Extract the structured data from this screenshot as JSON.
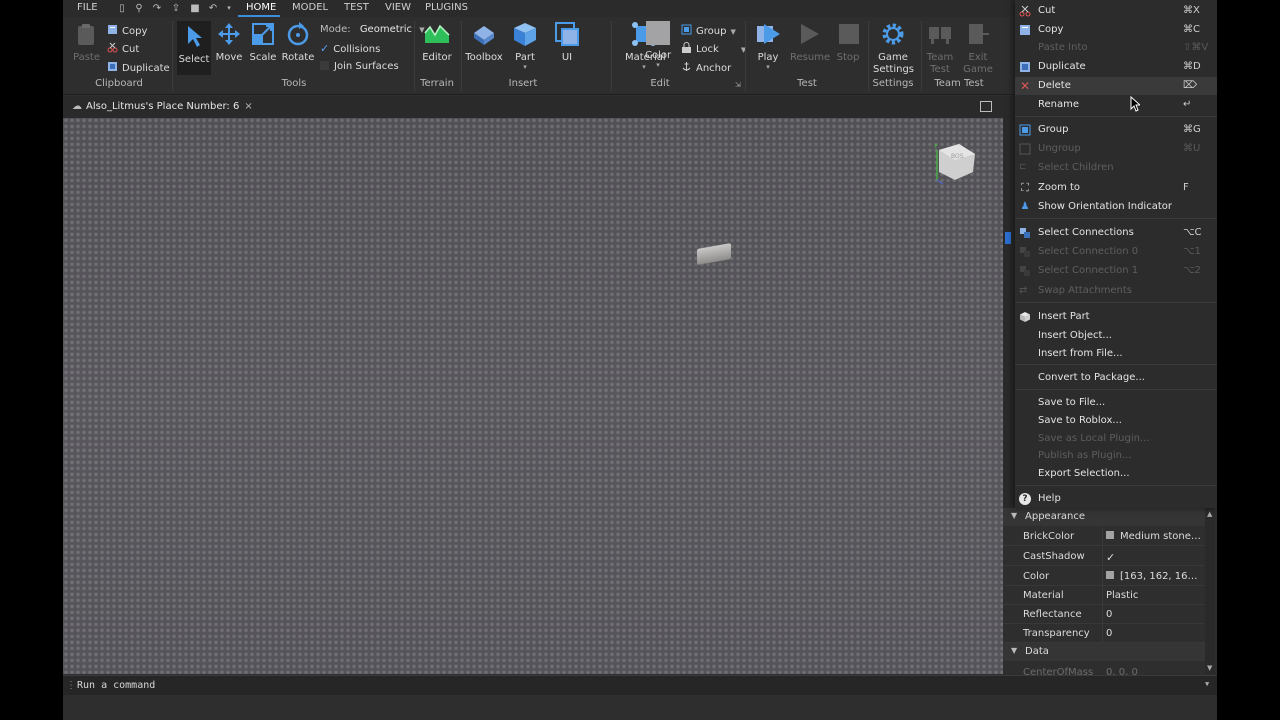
{
  "menubar": {
    "tabs": [
      "FILE",
      "HOME",
      "MODEL",
      "TEST",
      "VIEW",
      "PLUGINS"
    ],
    "active_tab": "HOME"
  },
  "ribbon": {
    "clipboard": {
      "paste": "Paste",
      "copy": "Copy",
      "cut": "Cut",
      "duplicate": "Duplicate",
      "label": "Clipboard"
    },
    "tools": {
      "select": "Select",
      "move": "Move",
      "scale": "Scale",
      "rotate": "Rotate",
      "mode_label": "Mode:",
      "mode_value": "Geometric",
      "collisions": "Collisions",
      "join_surfaces": "Join Surfaces",
      "label": "Tools"
    },
    "terrain": {
      "editor": "Editor",
      "label": "Terrain"
    },
    "insert": {
      "toolbox": "Toolbox",
      "part": "Part",
      "ui": "UI",
      "label": "Insert"
    },
    "edit": {
      "material": "Material",
      "color": "Color",
      "group": "Group",
      "lock": "Lock",
      "anchor": "Anchor",
      "label": "Edit"
    },
    "test": {
      "play": "Play",
      "resume": "Resume",
      "stop": "Stop",
      "label": "Test"
    },
    "settings": {
      "game_settings_1": "Game",
      "game_settings_2": "Settings",
      "label": "Settings"
    },
    "team_test": {
      "team_test_1": "Team",
      "team_test_2": "Test",
      "exit_game_1": "Exit",
      "exit_game_2": "Game",
      "label": "Team Test"
    }
  },
  "document": {
    "tab_title": "Also_Litmus's Place Number: 6",
    "close": "×"
  },
  "viewcube": {
    "y_label": "Y",
    "face_label": "BOS"
  },
  "context_menu": {
    "items": [
      {
        "label": "Cut",
        "shortcut": "⌘X",
        "disabled": false
      },
      {
        "label": "Copy",
        "shortcut": "⌘C",
        "disabled": false
      },
      {
        "label": "Paste Into",
        "shortcut": "⇧⌘V",
        "disabled": true
      },
      {
        "label": "Duplicate",
        "shortcut": "⌘D",
        "disabled": false
      },
      {
        "label": "Delete",
        "shortcut": "⌦",
        "disabled": false
      },
      {
        "label": "Rename",
        "shortcut": "↵",
        "disabled": false
      },
      {
        "label": "Group",
        "shortcut": "⌘G",
        "disabled": false
      },
      {
        "label": "Ungroup",
        "shortcut": "⌘U",
        "disabled": true
      },
      {
        "label": "Select Children",
        "shortcut": "",
        "disabled": true
      },
      {
        "label": "Zoom to",
        "shortcut": "F",
        "disabled": false
      },
      {
        "label": "Show Orientation Indicator",
        "shortcut": "",
        "disabled": false
      },
      {
        "label": "Select Connections",
        "shortcut": "⌥C",
        "disabled": false
      },
      {
        "label": "Select Connection 0",
        "shortcut": "⌥1",
        "disabled": true
      },
      {
        "label": "Select Connection 1",
        "shortcut": "⌥2",
        "disabled": true
      },
      {
        "label": "Swap Attachments",
        "shortcut": "",
        "disabled": true
      },
      {
        "label": "Insert Part",
        "shortcut": "",
        "disabled": false
      },
      {
        "label": "Insert Object...",
        "shortcut": "",
        "disabled": false
      },
      {
        "label": "Insert from File...",
        "shortcut": "",
        "disabled": false
      },
      {
        "label": "Convert to Package...",
        "shortcut": "",
        "disabled": false
      },
      {
        "label": "Save to File...",
        "shortcut": "",
        "disabled": false
      },
      {
        "label": "Save to Roblox...",
        "shortcut": "",
        "disabled": false
      },
      {
        "label": "Save as Local Plugin...",
        "shortcut": "",
        "disabled": true
      },
      {
        "label": "Publish as Plugin...",
        "shortcut": "",
        "disabled": true
      },
      {
        "label": "Export Selection...",
        "shortcut": "",
        "disabled": false
      },
      {
        "label": "Help",
        "shortcut": "",
        "disabled": false
      }
    ]
  },
  "properties": {
    "appearance_label": "Appearance",
    "rows": [
      {
        "name": "BrickColor",
        "value": "Medium stone ..."
      },
      {
        "name": "CastShadow",
        "value": "✓"
      },
      {
        "name": "Color",
        "value": "[163, 162, 165] (..."
      },
      {
        "name": "Material",
        "value": "Plastic"
      },
      {
        "name": "Reflectance",
        "value": "0"
      },
      {
        "name": "Transparency",
        "value": "0"
      }
    ],
    "data_label": "Data",
    "partial_row": {
      "name": "CenterOfMass",
      "value": "0, 0, 0"
    }
  },
  "command_bar": {
    "placeholder": "Run a command"
  },
  "colors": {
    "accent": "#3d8dde",
    "panel": "#2e2e2e",
    "viewport": "#555459"
  }
}
